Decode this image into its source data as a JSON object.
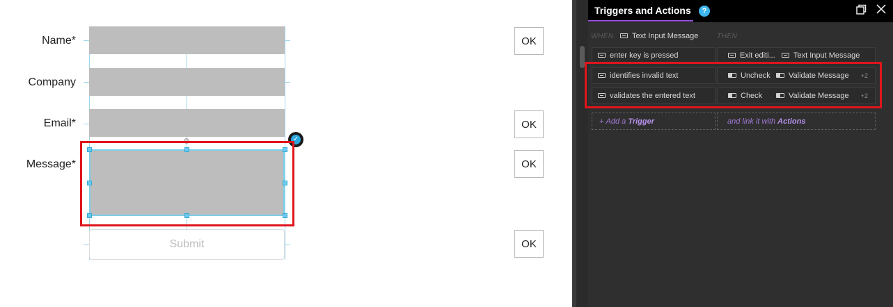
{
  "form": {
    "labels": {
      "name": "Name*",
      "company": "Company",
      "email": "Email*",
      "message": "Message*"
    },
    "submit_label": "Submit",
    "ok_buttons": [
      "OK",
      "OK",
      "OK",
      "OK"
    ]
  },
  "panel": {
    "title": "Triggers and Actions",
    "help": "?",
    "when_label": "WHEN",
    "when_target": "Text Input Message",
    "then_label": "THEN",
    "rows": [
      {
        "trigger": "enter key is pressed",
        "action1": "Exit editi...",
        "action2": "Text Input Message",
        "more": ""
      },
      {
        "trigger": "identifies invalid text",
        "action1": "Uncheck",
        "action2": "Validate Message",
        "more": "+2"
      },
      {
        "trigger": "validates the entered text",
        "action1": "Check",
        "action2": "Validate Message",
        "more": "+2"
      }
    ],
    "add_trigger_prefix": "Add a",
    "add_trigger_bold": "Trigger",
    "add_actions_prefix": "and link it with",
    "add_actions_bold": "Actions"
  },
  "colors": {
    "accent": "#9b59d6",
    "help": "#3db5ee",
    "highlight": "#e0151b",
    "selection": "#6ccbee"
  },
  "icons": {
    "restore": "restore-window-icon",
    "close": "close-icon",
    "help": "help-icon"
  }
}
